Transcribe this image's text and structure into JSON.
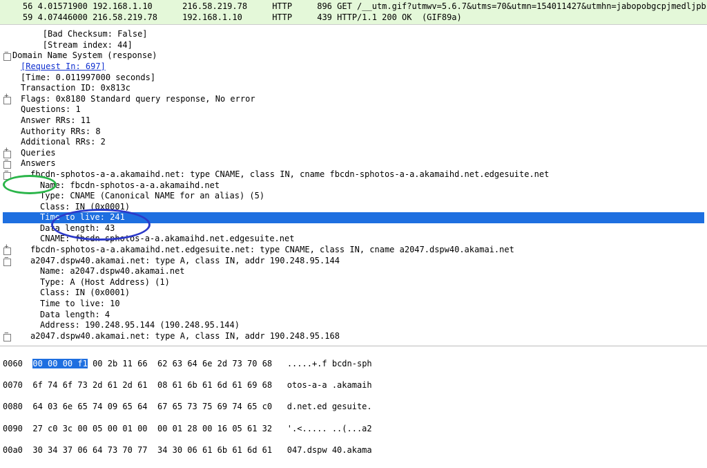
{
  "packets": [
    {
      "no": "    56",
      "time": "4.01571900",
      "src": "192.168.1.10",
      "dst": "216.58.219.78",
      "proto": "HTTP",
      "len": "896",
      "info": "GET /__utm.gif?utmwv=5.6.7&utms=70&utmn=154011427&utmhn=jabopobgcpjmedljpbcaablpmlmfcogm&utmt=e"
    },
    {
      "no": "    59",
      "time": "4.07446000",
      "src": "216.58.219.78",
      "dst": "192.168.1.10",
      "proto": "HTTP",
      "len": "439",
      "info": "HTTP/1.1 200 OK  (GIF89a)"
    }
  ],
  "det": {
    "badchk": "        [Bad Checksum: False]",
    "stream": "        [Stream index: 44]",
    "dns": "Domain Name System (response)",
    "req": "[Request In: 697]",
    "time": "[Time: 0.011997000 seconds]",
    "tid": "Transaction ID: 0x813c",
    "flags": "Flags: 0x8180 Standard query response, No error",
    "q": "Questions: 1",
    "arrs": "Answer RRs: 11",
    "auth": "Authority RRs: 8",
    "add": "Additional RRs: 2",
    "queries": "Queries",
    "answers": "Answers",
    "l1": "fbcdn-sphotos-a-a.akamaihd.net: type CNAME, class IN, cname fbcdn-sphotos-a-a.akamaihd.net.edgesuite.net",
    "l1a": "Name: fbcdn-sphotos-a-a.akamaihd.net",
    "l1b": "Type: CNAME (Canonical NAME for an alias) (5)",
    "l1c": "Class: IN (0x0001)",
    "l1d": "Time to live: 241",
    "l1e": "Data length: 43",
    "l1f": "CNAME: fbcdn-sphotos-a-a.akamaihd.net.edgesuite.net",
    "l2": "fbcdn-sphotos-a-a.akamaihd.net.edgesuite.net: type CNAME, class IN, cname a2047.dspw40.akamai.net",
    "l3": "a2047.dspw40.akamai.net: type A, class IN, addr 190.248.95.144",
    "l3a": "Name: a2047.dspw40.akamai.net",
    "l3b": "Type: A (Host Address) (1)",
    "l3c": "Class: IN (0x0001)",
    "l3d": "Time to live: 10",
    "l3e": "Data length: 4",
    "l3f": "Address: 190.248.95.144 (190.248.95.144)",
    "l4": "a2047.dspw40.akamai.net: type A, class IN, addr 190.248.95.168"
  },
  "hex": {
    "r1_off": "0060",
    "r1_bytes_sel": "00 00 00 f1",
    "r1_bytes": " 00 2b 11 66  62 63 64 6e 2d 73 70 68",
    "r1_ascii": " .....+.f bcdn-sph",
    "r2": "0070  6f 74 6f 73 2d 61 2d 61  08 61 6b 61 6d 61 69 68   otos-a-a .akamaih",
    "r3": "0080  64 03 6e 65 74 09 65 64  67 65 73 75 69 74 65 c0   d.net.ed gesuite.",
    "r4": "0090  27 c0 3c 00 05 00 01 00  00 01 28 00 16 05 61 32   '.<..... ..(...a2",
    "r5": "00a0  30 34 37 06 64 73 70 77  34 30 06 61 6b 61 6d 61   047.dspw 40.akama"
  }
}
